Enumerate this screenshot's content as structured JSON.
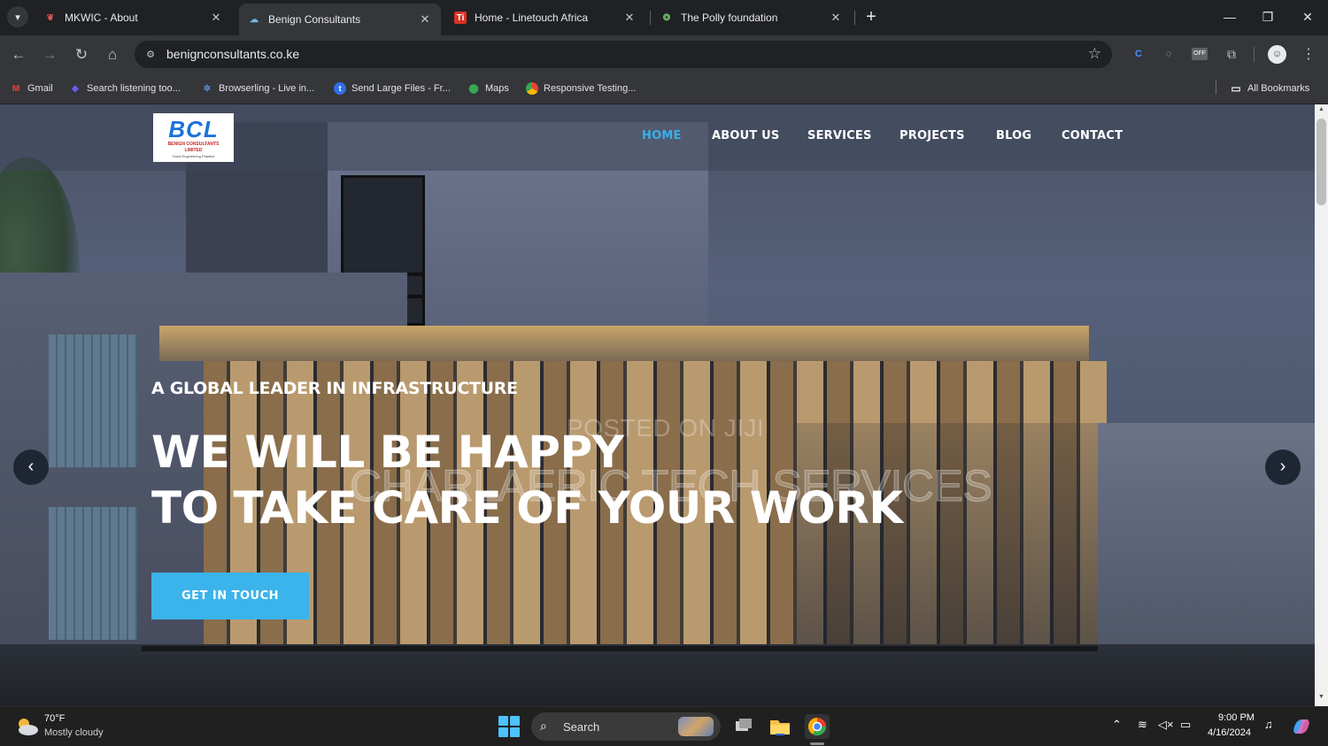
{
  "tabs": [
    {
      "title": "MKWIC - About",
      "active": false
    },
    {
      "title": "Benign Consultants",
      "active": true
    },
    {
      "title": "Home - Linetouch Africa",
      "active": false
    },
    {
      "title": "The Polly foundation",
      "active": false
    }
  ],
  "toolbar": {
    "url": "benignconsultants.co.ke"
  },
  "bookmarks": {
    "items": [
      {
        "label": "Gmail",
        "icon": "gmail-icon"
      },
      {
        "label": "Search listening too...",
        "icon": "search-listening-icon"
      },
      {
        "label": "Browserling - Live in...",
        "icon": "browserling-icon"
      },
      {
        "label": "Send Large Files - Fr...",
        "icon": "send-files-icon"
      },
      {
        "label": "Maps",
        "icon": "maps-icon"
      },
      {
        "label": "Responsive Testing...",
        "icon": "chrome-icon"
      }
    ],
    "all_bookmarks": "All Bookmarks"
  },
  "site": {
    "logo": {
      "mark": "BCL",
      "name": "BENIGN CONSULTANTS LIMITED",
      "tagline": "Good Engineering Practice"
    },
    "nav": [
      {
        "label": "HOME",
        "active": true
      },
      {
        "label": "ABOUT US",
        "active": false
      },
      {
        "label": "SERVICES",
        "active": false
      },
      {
        "label": "PROJECTS",
        "active": false
      },
      {
        "label": "BLOG",
        "active": false
      },
      {
        "label": "CONTACT",
        "active": false
      }
    ],
    "hero": {
      "kicker": "A GLOBAL LEADER IN INFRASTRUCTURE",
      "title_line1": "WE WILL BE HAPPY",
      "title_line2": "TO TAKE CARE OF YOUR WORK",
      "cta": "GET IN TOUCH",
      "prev": "‹",
      "next": "›"
    },
    "watermark": {
      "line1": "POSTED ON JIJI",
      "line2": "CHARLAERIC TECH SERVICES"
    }
  },
  "taskbar": {
    "weather": {
      "temp": "70°F",
      "desc": "Mostly cloudy"
    },
    "search_label": "Search",
    "clock": {
      "time": "9:00 PM",
      "date": "4/16/2024"
    }
  },
  "colors": {
    "accent": "#38b0e8",
    "cta": "#3ab4ea",
    "chrome_dark": "#202124",
    "chrome_toolbar": "#35363a"
  }
}
